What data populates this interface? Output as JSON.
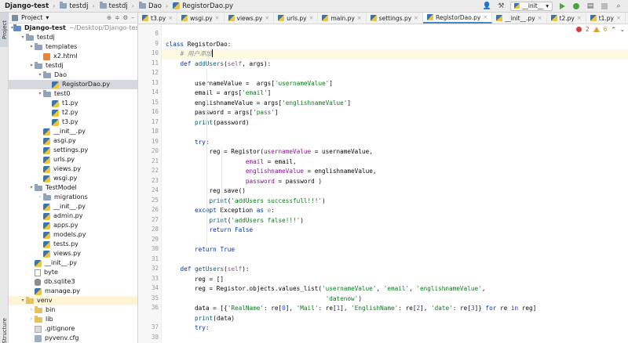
{
  "breadcrumb": [
    "Django-test",
    "testdj",
    "testdj",
    "Dao",
    "RegistorDao.py"
  ],
  "run_config": "__init__",
  "project_panel": {
    "title": "Project",
    "items": [
      {
        "label": "Django-test",
        "path": "~/Desktop/Django-test",
        "depth": 0,
        "icon": "folder-blue",
        "expanded": true
      },
      {
        "label": "testdj",
        "depth": 1,
        "icon": "folder",
        "expanded": true
      },
      {
        "label": "templates",
        "depth": 2,
        "icon": "folder",
        "expanded": true
      },
      {
        "label": "x2.html",
        "depth": 3,
        "icon": "html"
      },
      {
        "label": "testdj",
        "depth": 2,
        "icon": "folder",
        "expanded": true
      },
      {
        "label": "Dao",
        "depth": 3,
        "icon": "folder",
        "expanded": true
      },
      {
        "label": "RegistorDao.py",
        "depth": 4,
        "icon": "py",
        "selected": true
      },
      {
        "label": "test0",
        "depth": 3,
        "icon": "folder",
        "expanded": true
      },
      {
        "label": "t1.py",
        "depth": 4,
        "icon": "py"
      },
      {
        "label": "t2.py",
        "depth": 4,
        "icon": "py"
      },
      {
        "label": "t3.py",
        "depth": 4,
        "icon": "py"
      },
      {
        "label": "__init__.py",
        "depth": 3,
        "icon": "py"
      },
      {
        "label": "asgi.py",
        "depth": 3,
        "icon": "py"
      },
      {
        "label": "settings.py",
        "depth": 3,
        "icon": "py"
      },
      {
        "label": "urls.py",
        "depth": 3,
        "icon": "py"
      },
      {
        "label": "views.py",
        "depth": 3,
        "icon": "py"
      },
      {
        "label": "wsgi.py",
        "depth": 3,
        "icon": "py"
      },
      {
        "label": "TestModel",
        "depth": 2,
        "icon": "folder",
        "expanded": true
      },
      {
        "label": "migrations",
        "depth": 3,
        "icon": "folder",
        "expanded": false
      },
      {
        "label": "__init__.py",
        "depth": 3,
        "icon": "py"
      },
      {
        "label": "admin.py",
        "depth": 3,
        "icon": "py"
      },
      {
        "label": "apps.py",
        "depth": 3,
        "icon": "py"
      },
      {
        "label": "models.py",
        "depth": 3,
        "icon": "py"
      },
      {
        "label": "tests.py",
        "depth": 3,
        "icon": "py"
      },
      {
        "label": "views.py",
        "depth": 3,
        "icon": "py"
      },
      {
        "label": "__init__.py",
        "depth": 2,
        "icon": "py"
      },
      {
        "label": "byte",
        "depth": 2,
        "icon": "file"
      },
      {
        "label": "db.sqlite3",
        "depth": 2,
        "icon": "db"
      },
      {
        "label": "manage.py",
        "depth": 2,
        "icon": "py"
      },
      {
        "label": "venv",
        "depth": 1,
        "icon": "folder-yellow",
        "expanded": true,
        "venv": true
      },
      {
        "label": "bin",
        "depth": 2,
        "icon": "folder-yellow",
        "expanded": false
      },
      {
        "label": "lib",
        "depth": 2,
        "icon": "folder-yellow",
        "expanded": false
      },
      {
        "label": ".gitignore",
        "depth": 2,
        "icon": "git"
      },
      {
        "label": "pyvenv.cfg",
        "depth": 2,
        "icon": "cfg"
      }
    ]
  },
  "left_strip": {
    "project_tab": "Project",
    "structure_tab": "Structure"
  },
  "tabs": [
    {
      "label": "t3.py",
      "active": false
    },
    {
      "label": "wsgi.py",
      "active": false
    },
    {
      "label": "views.py",
      "active": false
    },
    {
      "label": "urls.py",
      "active": false
    },
    {
      "label": "main.py",
      "active": false
    },
    {
      "label": "settings.py",
      "active": false
    },
    {
      "label": "RegistorDao.py",
      "active": true
    },
    {
      "label": "__init__.py",
      "active": false
    },
    {
      "label": "t2.py",
      "active": false
    },
    {
      "label": "t1.py",
      "active": false
    }
  ],
  "inspections": {
    "errors": "2",
    "warnings": "6"
  },
  "code": {
    "line_numbers": [
      "8",
      "9",
      "10",
      "11",
      "12",
      "13",
      "14",
      "15",
      "16",
      "17",
      "18",
      "19",
      "20",
      "21",
      "22",
      "23",
      "24",
      "25",
      "26",
      "27",
      "28",
      "29",
      "30",
      "31",
      "32",
      "33",
      "34",
      "35",
      "36",
      "",
      "37",
      "38"
    ],
    "comment_text": "# 用户添加",
    "lines": [
      "",
      "class RegistorDao:",
      "    # 用户添加",
      "    def addUsers(self, args):",
      "",
      "        usernameValue =  args['usernameValue']",
      "        email = args['email']",
      "        englishnameValue = args['englishnameValue']",
      "        password = args['pass']",
      "        print(password)",
      "",
      "        try:",
      "            reg = Registor(usernameValue = usernameValue,",
      "                      email = email,",
      "                      englishnameValue = englishnameValue,",
      "                      password = password )",
      "            reg.save()",
      "            print('addUsers successfull!!!')",
      "        except Exception as e:",
      "            print('addUsers false!!!')",
      "            return False",
      "",
      "        return True",
      "",
      "    def getUsers(self):",
      "        reg = []",
      "        reg = Registor.objects.values_list('usernameValue', 'email', 'englishnameValue',",
      "                                            'datenow')",
      "        data = [{'RealName': re[0], 'Mail': re[1], 'EnglishName': re[2], 'date': re[3]} for re in reg]",
      "        print(data)",
      "        try:"
    ]
  }
}
